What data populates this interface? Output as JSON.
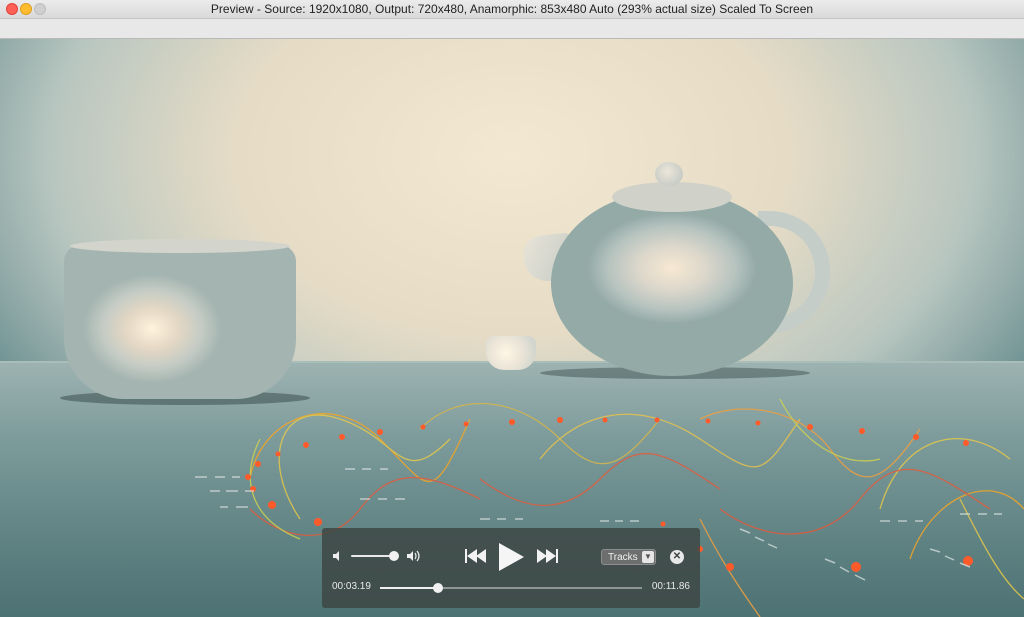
{
  "window": {
    "title": "Preview - Source: 1920x1080, Output: 720x480, Anamorphic: 853x480 Auto (293% actual size) Scaled To Screen"
  },
  "player": {
    "volume_level": 0.9,
    "transport": [
      "rewind",
      "play",
      "fast-forward"
    ],
    "tracks_label": "Tracks",
    "time_current": "00:03.19",
    "time_total": "00:11.86",
    "progress": 0.22
  },
  "icons": [
    "volume-low-icon",
    "volume-high-icon",
    "rewind-icon",
    "play-icon",
    "fast-forward-icon",
    "chevron-down-icon",
    "close-icon"
  ]
}
